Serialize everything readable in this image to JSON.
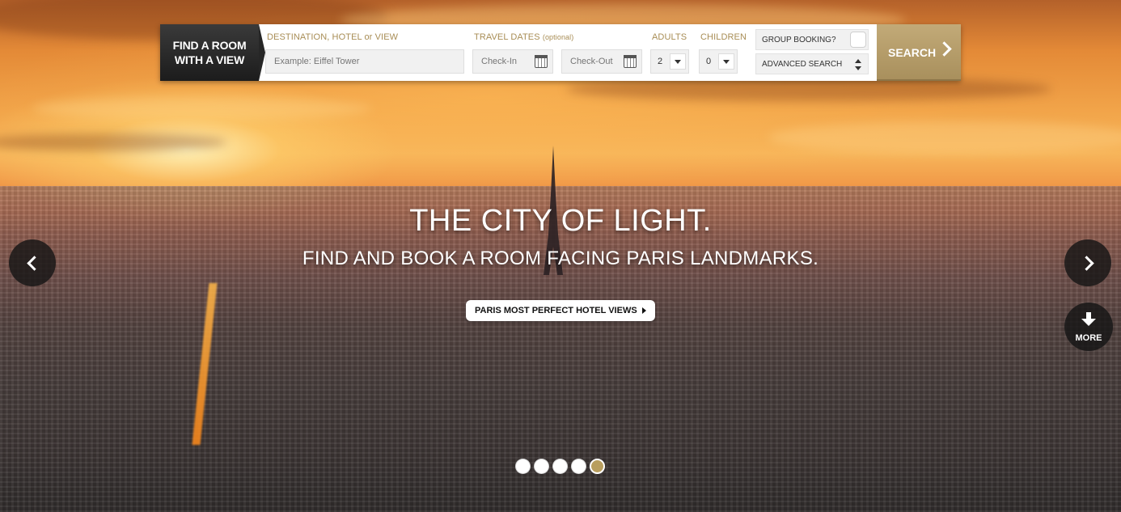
{
  "brand": {
    "line1": "FIND A ROOM",
    "line2": "WITH A VIEW"
  },
  "search": {
    "destination_label": "DESTINATION, HOTEL or VIEW",
    "destination_placeholder": "Example: Eiffel Tower",
    "dates_label": "TRAVEL DATES",
    "dates_optional": "(optional)",
    "checkin_placeholder": "Check-In",
    "checkout_placeholder": "Check-Out",
    "adults_label": "ADULTS",
    "adults_value": "2",
    "children_label": "CHILDREN",
    "children_value": "0",
    "group_booking_label": "GROUP BOOKING?",
    "advanced_search_label": "ADVANCED SEARCH",
    "search_button": "SEARCH"
  },
  "hero": {
    "title": "THE CITY OF LIGHT.",
    "subtitle": "FIND AND BOOK A ROOM FACING PARIS LANDMARKS.",
    "cta": "PARIS MOST PERFECT HOTEL VIEWS",
    "more_label": "MORE"
  },
  "slider": {
    "slide_count": 5,
    "active_slide": 5
  },
  "colors": {
    "accent": "#b89e5e",
    "label": "#a88d55",
    "brand_bg": "#1c1c1c"
  },
  "icons": [
    "calendar-icon",
    "chevron-down-icon",
    "updown-icon",
    "chevron-right-icon",
    "arrow-left-icon",
    "arrow-right-icon",
    "arrow-down-icon"
  ]
}
